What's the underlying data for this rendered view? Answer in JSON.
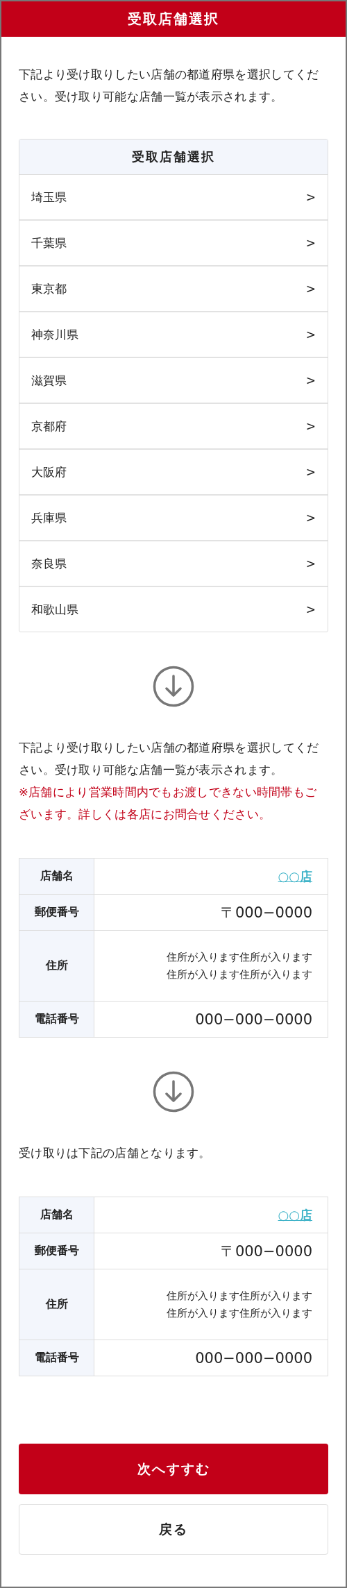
{
  "header": {
    "title": "受取店舗選択"
  },
  "intro": "下記より受け取りしたい店舗の都道府県を選択してください。受け取り可能な店舗一覧が表示されます。",
  "store_select": {
    "title": "受取店舗選択",
    "items": [
      {
        "label": "埼玉県",
        "chevron": ">"
      },
      {
        "label": "千葉県",
        "chevron": ">"
      },
      {
        "label": "東京都",
        "chevron": ">"
      },
      {
        "label": "神奈川県",
        "chevron": ">"
      },
      {
        "label": "滋賀県",
        "chevron": ">"
      },
      {
        "label": "京都府",
        "chevron": ">"
      },
      {
        "label": "大阪府",
        "chevron": ">"
      },
      {
        "label": "兵庫県",
        "chevron": ">"
      },
      {
        "label": "奈良県",
        "chevron": ">"
      },
      {
        "label": "和歌山県",
        "chevron": ">"
      }
    ]
  },
  "sections": [
    {
      "text": "下記より受け取りしたい店舗の都道府県を選択してください。受け取り可能な店舗一覧が表示されます。",
      "warning": "※店舗により営業時間内でもお渡しできない時間帯もございます。詳しくは各店にお問合せください。",
      "rows": [
        {
          "label": "店舗名",
          "kind": "link",
          "value": [
            "○○店"
          ]
        },
        {
          "label": "郵便番号",
          "kind": "large",
          "value": [
            "〒000−0000"
          ]
        },
        {
          "label": "住所",
          "kind": "small",
          "value": [
            "住所が入ります住所が入ります",
            "住所が入ります住所が入ります"
          ]
        },
        {
          "label": "電話番号",
          "kind": "large",
          "value": [
            "000−000−0000"
          ]
        }
      ]
    },
    {
      "text": "受け取りは下記の店舗となります。",
      "rows": [
        {
          "label": "店舗名",
          "kind": "link",
          "value": [
            "○○店"
          ]
        },
        {
          "label": "郵便番号",
          "kind": "large",
          "value": [
            "〒000−0000"
          ]
        },
        {
          "label": "住所",
          "kind": "small",
          "value": [
            "住所が入ります住所が入ります",
            "住所が入ります住所が入ります"
          ]
        },
        {
          "label": "電話番号",
          "kind": "large",
          "value": [
            "000−000−0000"
          ]
        }
      ]
    }
  ],
  "buttons": [
    {
      "label": "次へすすむ",
      "kind": "primary"
    },
    {
      "label": "戻る",
      "kind": "secondary"
    }
  ]
}
